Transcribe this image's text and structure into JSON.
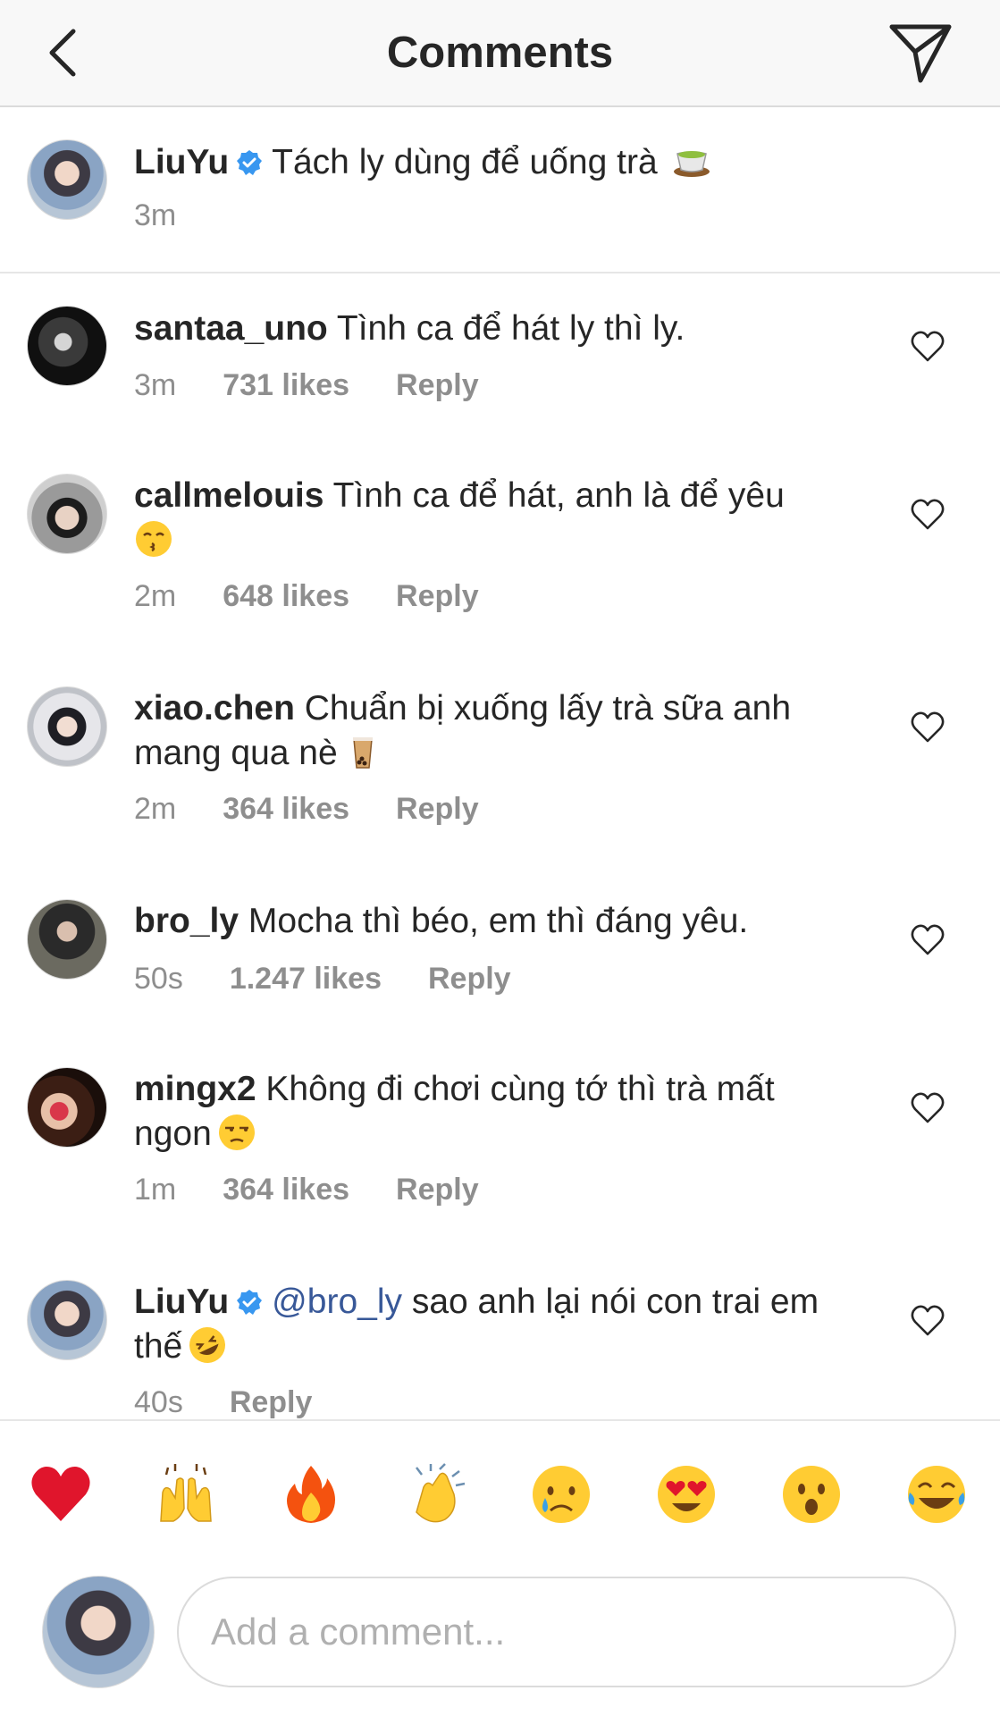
{
  "header": {
    "title": "Comments"
  },
  "caption": {
    "username": "LiuYu",
    "text": "Tách ly dùng để uống trà",
    "time": "3m"
  },
  "comments": [
    {
      "username": "santaa_uno",
      "text": "Tình ca để hát ly thì ly.",
      "time": "3m",
      "likes": "731 likes",
      "reply": "Reply"
    },
    {
      "username": "callmelouis",
      "text": "Tình ca để hát, anh là để yêu",
      "time": "2m",
      "likes": "648 likes",
      "reply": "Reply"
    },
    {
      "username": "xiao.chen",
      "text": "Chuẩn bị xuống lấy trà sữa anh mang qua nè",
      "time": "2m",
      "likes": "364 likes",
      "reply": "Reply"
    },
    {
      "username": "bro_ly",
      "text": "Mocha thì béo, em thì đáng yêu.",
      "time": "50s",
      "likes": "1.247 likes",
      "reply": "Reply"
    },
    {
      "username": "mingx2",
      "text": "Không đi chơi cùng tớ thì trà mất ngon",
      "time": "1m",
      "likes": "364 likes",
      "reply": "Reply"
    },
    {
      "username": "LiuYu",
      "mention": "@bro_ly",
      "text": "sao anh lại nói con trai em thế",
      "time": "40s",
      "reply": "Reply"
    }
  ],
  "quick_emojis": [
    "heart",
    "raising-hands",
    "fire",
    "clapping-hands",
    "crying-face",
    "heart-eyes",
    "surprised-face",
    "tears-of-joy"
  ],
  "composer": {
    "placeholder": "Add a comment..."
  },
  "colors": {
    "verified": "#3897f0",
    "mention": "#385898",
    "meta": "#8e8e8e",
    "text": "#262626"
  }
}
